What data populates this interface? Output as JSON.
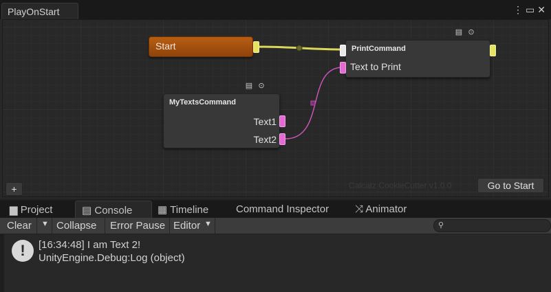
{
  "window": {
    "tab_title": "PlayOnStart",
    "controls": "⋮ ▭ ✕"
  },
  "graph": {
    "start_node": {
      "label": "Start"
    },
    "print_node": {
      "title": "PrintCommand",
      "port_label": "Text to Print"
    },
    "texts_node": {
      "title": "MyTextsCommand",
      "ports": [
        "Text1",
        "Text2"
      ]
    },
    "add_button": "+",
    "watermark": "Calcatz CookieCutter v1.0.0",
    "goto_button": "Go to Start",
    "node_icons": [
      "document-icon",
      "gear-circle-icon"
    ],
    "colors": {
      "start": "#a5530f",
      "pink_port": "#e36ad3",
      "yellow_port": "#e6e35f",
      "wire_pink": "#c855b8",
      "wire_yellow": "#d9d85a"
    }
  },
  "bottom_tabs": [
    {
      "label": "Project",
      "icon": "folder-icon"
    },
    {
      "label": "Console",
      "icon": "console-icon",
      "active": true
    },
    {
      "label": "Timeline",
      "icon": "film-icon"
    },
    {
      "label": "Command Inspector",
      "icon": ""
    },
    {
      "label": "Animator",
      "icon": "animator-icon"
    }
  ],
  "toolbar": {
    "clear": "Clear",
    "collapse": "Collapse",
    "error_pause": "Error Pause",
    "editor": "Editor",
    "search_placeholder": ""
  },
  "log": {
    "line1": "[16:34:48] I am Text 2!",
    "line2": "UnityEngine.Debug:Log (object)"
  }
}
